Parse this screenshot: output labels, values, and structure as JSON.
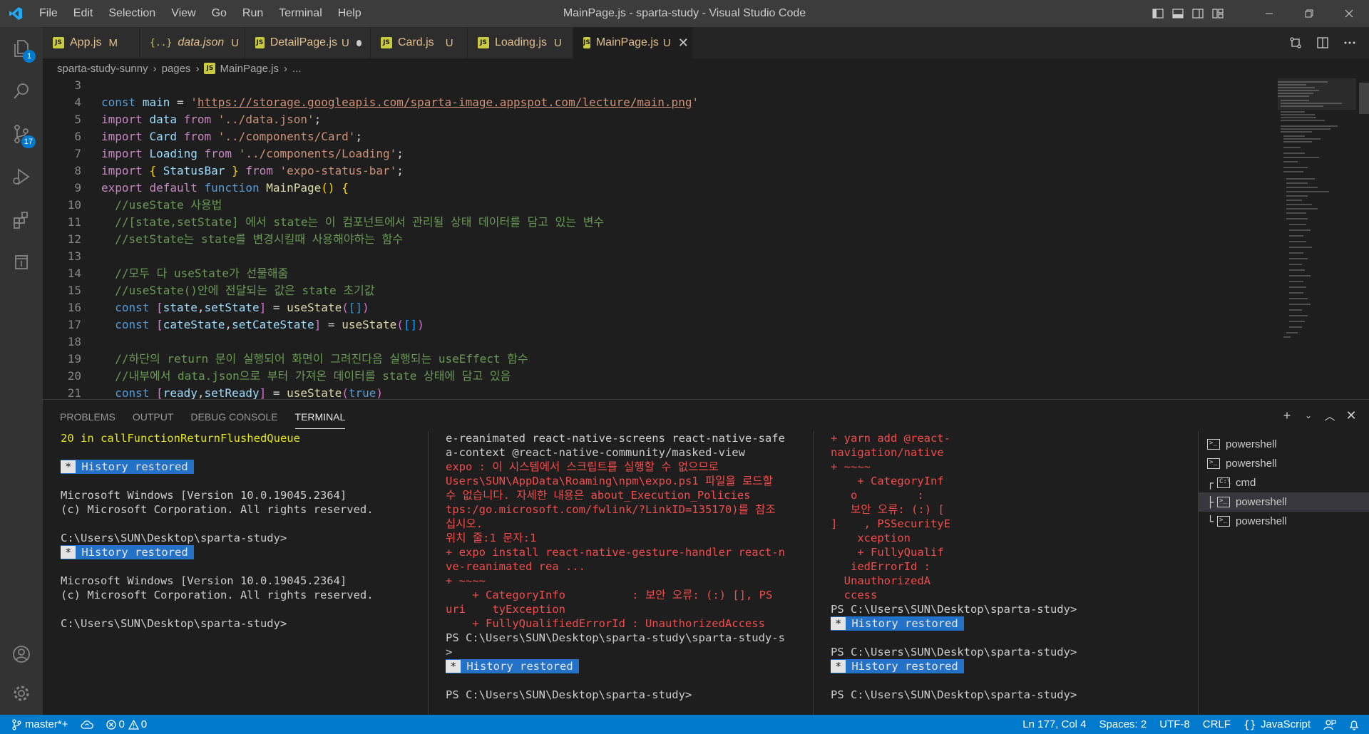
{
  "window": {
    "title": "MainPage.js - sparta-study - Visual Studio Code",
    "menu": [
      "File",
      "Edit",
      "Selection",
      "View",
      "Go",
      "Run",
      "Terminal",
      "Help"
    ]
  },
  "activity": {
    "explorer_badge": "1",
    "scm_badge": "17"
  },
  "tabs": [
    {
      "label": "App.js",
      "status": "M",
      "type": "js"
    },
    {
      "label": "data.json",
      "status": "U",
      "type": "json"
    },
    {
      "label": "DetailPage.js",
      "status": "U",
      "type": "js",
      "dirty": true
    },
    {
      "label": "Card.js",
      "status": "U",
      "type": "js"
    },
    {
      "label": "Loading.js",
      "status": "U",
      "type": "js"
    },
    {
      "label": "MainPage.js",
      "status": "U",
      "type": "js",
      "active": true
    }
  ],
  "breadcrumbs": [
    "sparta-study-sunny",
    "pages",
    "MainPage.js",
    "..."
  ],
  "editor": {
    "line_numbers": [
      "3",
      "4",
      "5",
      "6",
      "7",
      "8",
      "9",
      "10",
      "11",
      "12",
      "13",
      "14",
      "15",
      "16",
      "17",
      "18",
      "19",
      "20",
      "21"
    ],
    "lines": {
      "l4": {
        "kw": "const",
        "name": "main",
        "eq": " = ",
        "q1": "'",
        "url": "https://storage.googleapis.com/sparta-image.appspot.com/lecture/main.png",
        "q2": "'"
      },
      "l5": {
        "imp": "import",
        "name": "data",
        "from": "from",
        "src": "'../data.json'",
        "end": ";"
      },
      "l6": {
        "imp": "import",
        "name": "Card",
        "from": "from",
        "src": "'../components/Card'",
        "end": ";"
      },
      "l7": {
        "imp": "import",
        "name": "Loading",
        "from": "from",
        "src": "'../components/Loading'",
        "end": ";"
      },
      "l8": {
        "imp": "import",
        "ob": "{",
        "name": "StatusBar",
        "cb": "}",
        "from": "from",
        "src": "'expo-status-bar'",
        "end": ";"
      },
      "l9": {
        "exp": "export",
        "def": "default",
        "fn": "function",
        "name": "MainPage",
        "paren": "()",
        "ob": "{"
      },
      "l10": "//useState 사용법",
      "l11": "//[state,setState] 에서 state는 이 컴포넌트에서 관리될 상태 데이터를 담고 있는 변수",
      "l12": "//setState는 state를 변경시킬때 사용해야하는 함수",
      "l14": "//모두 다 useState가 선물해줌",
      "l15": "//useState()안에 전달되는 값은 state 초기값",
      "l16": {
        "kw": "const",
        "ob": "[",
        "a": "state",
        "comma": ",",
        "b": "setState",
        "cb": "]",
        "eq": " = ",
        "fn": "useState",
        "op": "(",
        "arg_o": "[",
        "arg_c": "]",
        "cp": ")"
      },
      "l17": {
        "kw": "const",
        "ob": "[",
        "a": "cateState",
        "comma": ",",
        "b": "setCateState",
        "cb": "]",
        "eq": " = ",
        "fn": "useState",
        "op": "(",
        "arg_o": "[",
        "arg_c": "]",
        "cp": ")"
      },
      "l19": "//하단의 return 문이 실행되어 화면이 그려진다음 실행되는 useEffect 함수",
      "l20": "//내부에서 data.json으로 부터 가져온 데이터를 state 상태에 담고 있음",
      "l21": {
        "kw": "const",
        "ob": "[",
        "a": "ready",
        "comma": ",",
        "b": "setReady",
        "cb": "]",
        "eq": " = ",
        "fn": "useState",
        "op": "(",
        "arg": "true",
        "cp": ")"
      }
    }
  },
  "panel": {
    "tabs": [
      "PROBLEMS",
      "OUTPUT",
      "DEBUG CONSOLE",
      "TERMINAL"
    ],
    "active_tab": "TERMINAL"
  },
  "terminal1": {
    "l1": "20 in callFunctionReturnFlushedQueue",
    "hist": "History restored",
    "star": "*",
    "win1": "Microsoft Windows [Version 10.0.19045.2364]",
    "win2": "(c) Microsoft Corporation. All rights reserved.",
    "prompt": "C:\\Users\\SUN\\Desktop\\sparta-study>"
  },
  "terminal2": {
    "lines": [
      "e-reanimated react-native-screens react-native-safe",
      "a-context @react-native-community/masked-view",
      "expo : 이 시스템에서 스크립트를 실행할 수 없으므로",
      "Users\\SUN\\AppData\\Roaming\\npm\\expo.ps1 파일을 로드할",
      "수 없습니다. 자세한 내용은 about_Execution_Policies",
      "tps:/go.microsoft.com/fwlink/?LinkID=135170)를 참조",
      "십시오.",
      "위치 줄:1 문자:1",
      "+ expo install react-native-gesture-handler react-n",
      "ve-reanimated rea ...",
      "+ ~~~~",
      "    + CategoryInfo          : 보안 오류: (:) [], PS",
      "uri    tyException",
      "    + FullyQualifiedErrorId : UnauthorizedAccess",
      "PS C:\\Users\\SUN\\Desktop\\sparta-study\\sparta-study-s",
      ">",
      "History restored",
      "PS C:\\Users\\SUN\\Desktop\\sparta-study>"
    ]
  },
  "terminal3": {
    "lines": [
      "+ yarn add @react-",
      "navigation/native",
      "+ ~~~~",
      "    + CategoryInf",
      "   o         :",
      "   보안 오류: (:) [",
      "]    , PSSecurityE",
      "    xception",
      "    + FullyQualif",
      "   iedErrorId :",
      "  UnauthorizedA",
      "  ccess",
      "PS C:\\Users\\SUN\\Desktop\\sparta-study>",
      "History restored",
      "PS C:\\Users\\SUN\\Desktop\\sparta-study>",
      "History restored",
      "PS C:\\Users\\SUN\\Desktop\\sparta-study>"
    ]
  },
  "terminal_list": [
    "powershell",
    "powershell",
    "cmd",
    "powershell",
    "powershell"
  ],
  "statusbar": {
    "branch": "master*+",
    "errors": "0",
    "warnings": "0",
    "position": "Ln 177, Col 4",
    "spaces": "Spaces: 2",
    "encoding": "UTF-8",
    "eol": "CRLF",
    "language": "JavaScript"
  },
  "colors": {
    "accent": "#007acc",
    "titlebar": "#3c3c3c",
    "activitybar": "#333333",
    "editor_bg": "#1e1e1e",
    "modified": "#e2c08d",
    "history_bg": "#2472c8"
  }
}
